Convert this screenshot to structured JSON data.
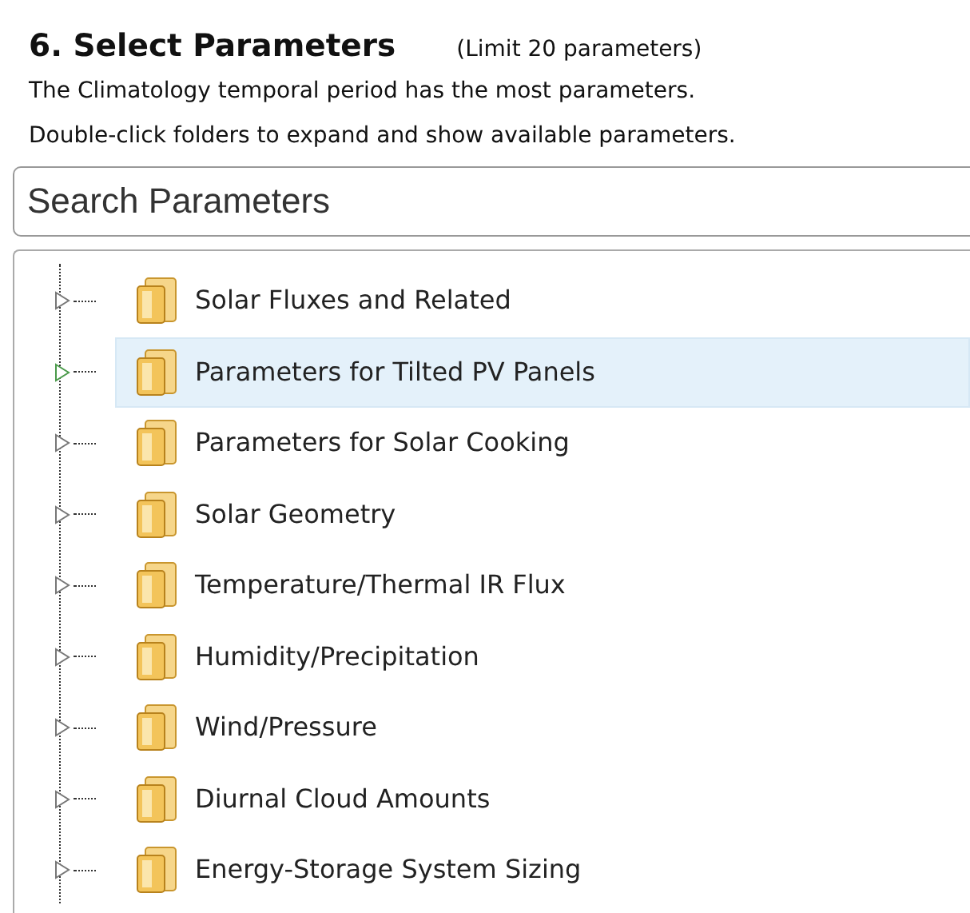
{
  "header": {
    "title": "6. Select Parameters",
    "limit": "(Limit 20 parameters)"
  },
  "notes": [
    "The Climatology temporal period has the most parameters.",
    "Double-click folders to expand and show available parameters."
  ],
  "search": {
    "placeholder": "Search Parameters"
  },
  "tree": [
    {
      "label": "Solar Fluxes and Related",
      "expanded": false,
      "selected": false
    },
    {
      "label": "Parameters for Tilted PV Panels",
      "expanded": false,
      "selected": true
    },
    {
      "label": "Parameters for Solar Cooking",
      "expanded": false,
      "selected": false
    },
    {
      "label": "Solar Geometry",
      "expanded": false,
      "selected": false
    },
    {
      "label": "Temperature/Thermal IR Flux",
      "expanded": false,
      "selected": false
    },
    {
      "label": "Humidity/Precipitation",
      "expanded": false,
      "selected": false
    },
    {
      "label": "Wind/Pressure",
      "expanded": false,
      "selected": false
    },
    {
      "label": "Diurnal Cloud Amounts",
      "expanded": false,
      "selected": false
    },
    {
      "label": "Energy-Storage System Sizing",
      "expanded": false,
      "selected": false
    }
  ]
}
